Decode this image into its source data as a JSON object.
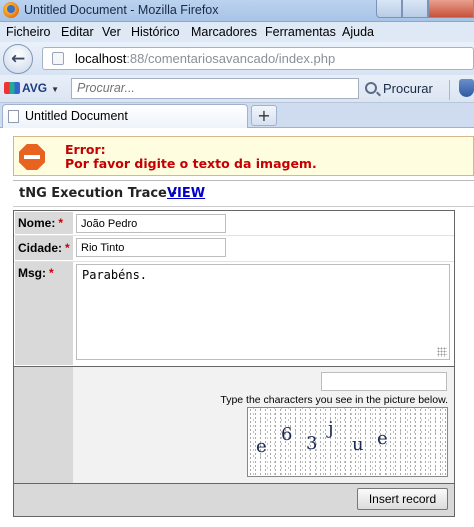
{
  "window": {
    "title": "Untitled Document - Mozilla Firefox"
  },
  "menu": [
    "Ficheiro",
    "Editar",
    "Ver",
    "Histórico",
    "Marcadores",
    "Ferramentas",
    "Ajuda"
  ],
  "nav": {
    "url_host": "localhost",
    "url_rest": ":88/comentariosavancado/index.php"
  },
  "avg": {
    "brand": "AVG",
    "search_placeholder": "Procurar...",
    "search_button": "Procurar"
  },
  "tabs": [
    {
      "label": "Untitled Document"
    }
  ],
  "newtab_label": "+",
  "error": {
    "title": "Error:",
    "message": "Por favor digite o texto da imagem."
  },
  "trace": {
    "label": "tNG Execution Trace - ",
    "link": "VIEW"
  },
  "form": {
    "nome_label": "Nome:",
    "nome_value": "João Pedro",
    "cidade_label": "Cidade:",
    "cidade_value": "Rio Tinto",
    "msg_label": "Msg:",
    "msg_value": "Parabéns.",
    "required_mark": "*",
    "captcha_hint": "Type the characters you see in the picture below.",
    "captcha_value": "",
    "captcha_chars": [
      "e",
      "6",
      "3",
      "j",
      "u",
      "e"
    ],
    "submit_label": "Insert record"
  },
  "colors": {
    "error_text": "#c60000",
    "error_bg": "#fffde0",
    "link": "#0000cc",
    "required": "#cc0000"
  }
}
